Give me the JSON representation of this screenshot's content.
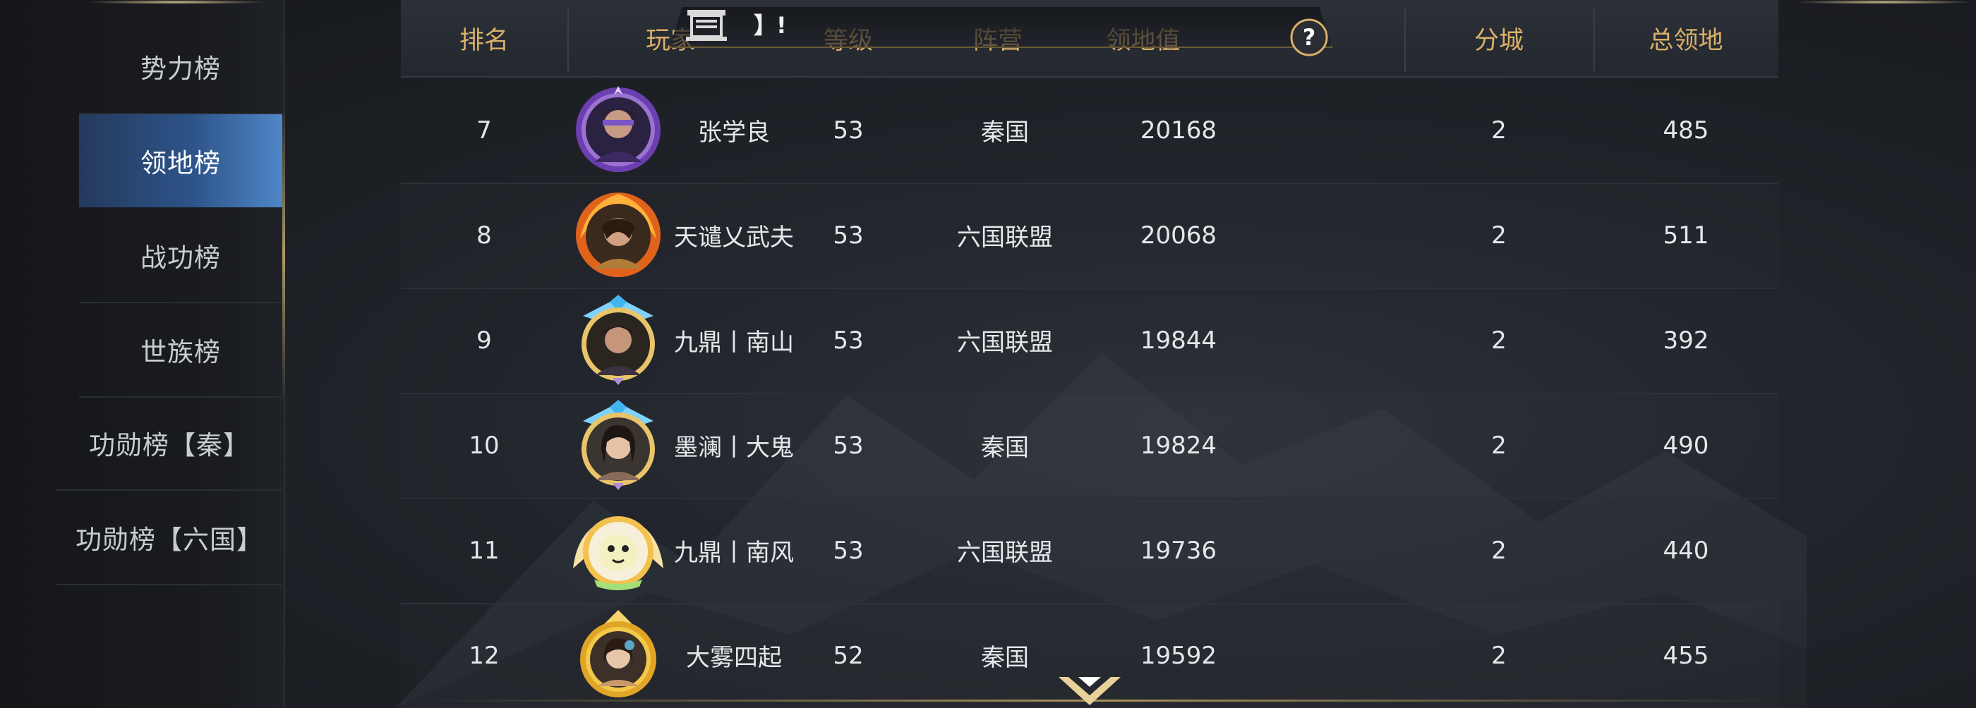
{
  "sidebar": {
    "items": [
      {
        "label": "势力榜",
        "active": false
      },
      {
        "label": "领地榜",
        "active": true
      },
      {
        "label": "战功榜",
        "active": false
      },
      {
        "label": "世族榜",
        "active": false
      },
      {
        "label": "功勋榜【秦】",
        "active": false
      },
      {
        "label": "功勋榜【六国】",
        "active": false
      }
    ]
  },
  "title": {
    "text": "】!"
  },
  "table": {
    "headers": {
      "rank": "排名",
      "player": "玩家",
      "level": "等级",
      "camp": "阵营",
      "territory_value": "领地值",
      "branch_city": "分城",
      "total_territory": "总领地"
    },
    "rows": [
      {
        "rank": "7",
        "name": "张学良",
        "level": "53",
        "camp": "秦国",
        "value": "20168",
        "city": "2",
        "total": "485",
        "avatar": "purple-frame-avatar-icon"
      },
      {
        "rank": "8",
        "name": "天谴乂武夫",
        "level": "53",
        "camp": "六国联盟",
        "value": "20068",
        "city": "2",
        "total": "511",
        "avatar": "fire-frame-avatar-icon"
      },
      {
        "rank": "9",
        "name": "九鼎丨南山",
        "level": "53",
        "camp": "六国联盟",
        "value": "19844",
        "city": "2",
        "total": "392",
        "avatar": "crystal-frame-avatar-icon"
      },
      {
        "rank": "10",
        "name": "墨澜丨大鬼",
        "level": "53",
        "camp": "秦国",
        "value": "19824",
        "city": "2",
        "total": "490",
        "avatar": "crystal-frame-avatar-icon"
      },
      {
        "rank": "11",
        "name": "九鼎丨南风",
        "level": "53",
        "camp": "六国联盟",
        "value": "19736",
        "city": "2",
        "total": "440",
        "avatar": "golden-wing-avatar-icon"
      },
      {
        "rank": "12",
        "name": "大雾四起",
        "level": "52",
        "camp": "秦国",
        "value": "19592",
        "city": "2",
        "total": "455",
        "avatar": "gold-crest-avatar-icon"
      }
    ]
  },
  "colors": {
    "header_text": "#d9b06a",
    "row_text": "#e6e7ea",
    "active_tab": "#2d5388"
  }
}
